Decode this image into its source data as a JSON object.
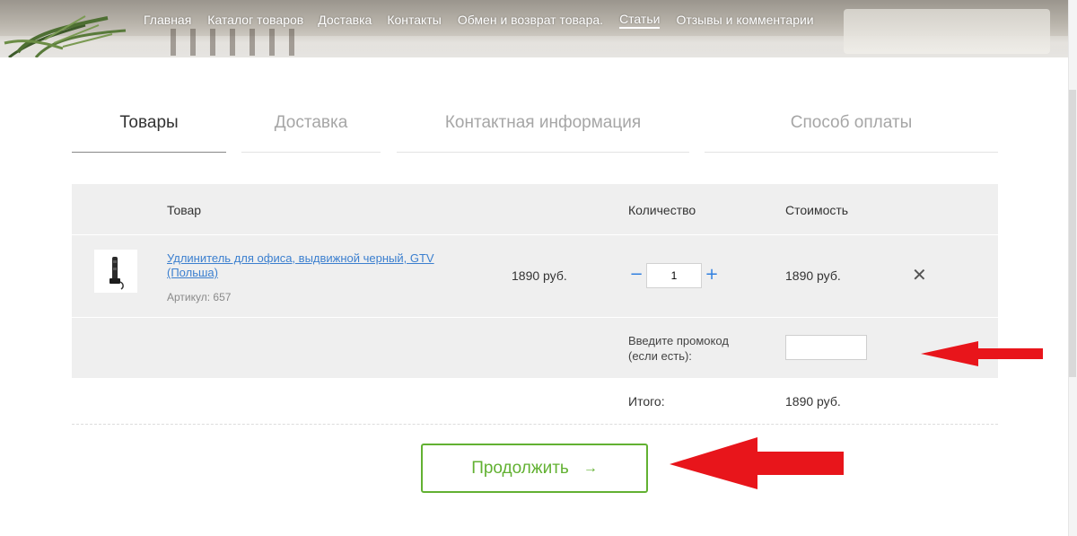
{
  "nav": {
    "items": [
      "Главная",
      "Каталог товаров",
      "Доставка",
      "Контакты",
      "Обмен и возврат товара.",
      "Статьи",
      "Отзывы и комментарии"
    ]
  },
  "steps": {
    "tabs": [
      "Товары",
      "Доставка",
      "Контактная информация",
      "Способ оплаты"
    ],
    "active": "Товары"
  },
  "cart": {
    "headers": {
      "product": "Товар",
      "quantity": "Количество",
      "cost": "Стоимость"
    },
    "item": {
      "name": "Удлинитель для офиса, выдвижной черный, GTV (Польша)",
      "sku": "Артикул: 657",
      "price": "1890 руб.",
      "quantity": "1",
      "cost": "1890 руб.",
      "minus": "−",
      "plus": "+",
      "remove": "✕"
    },
    "promo": {
      "label": "Введите промокод (если есть):",
      "value": ""
    },
    "total": {
      "label": "Итого:",
      "value": "1890 руб."
    }
  },
  "actions": {
    "continue_label": "Продолжить",
    "continue_arrow": "→"
  },
  "colors": {
    "accent_green": "#62b132",
    "link_blue": "#3b7fcf",
    "annotation_red": "#e8151b"
  }
}
